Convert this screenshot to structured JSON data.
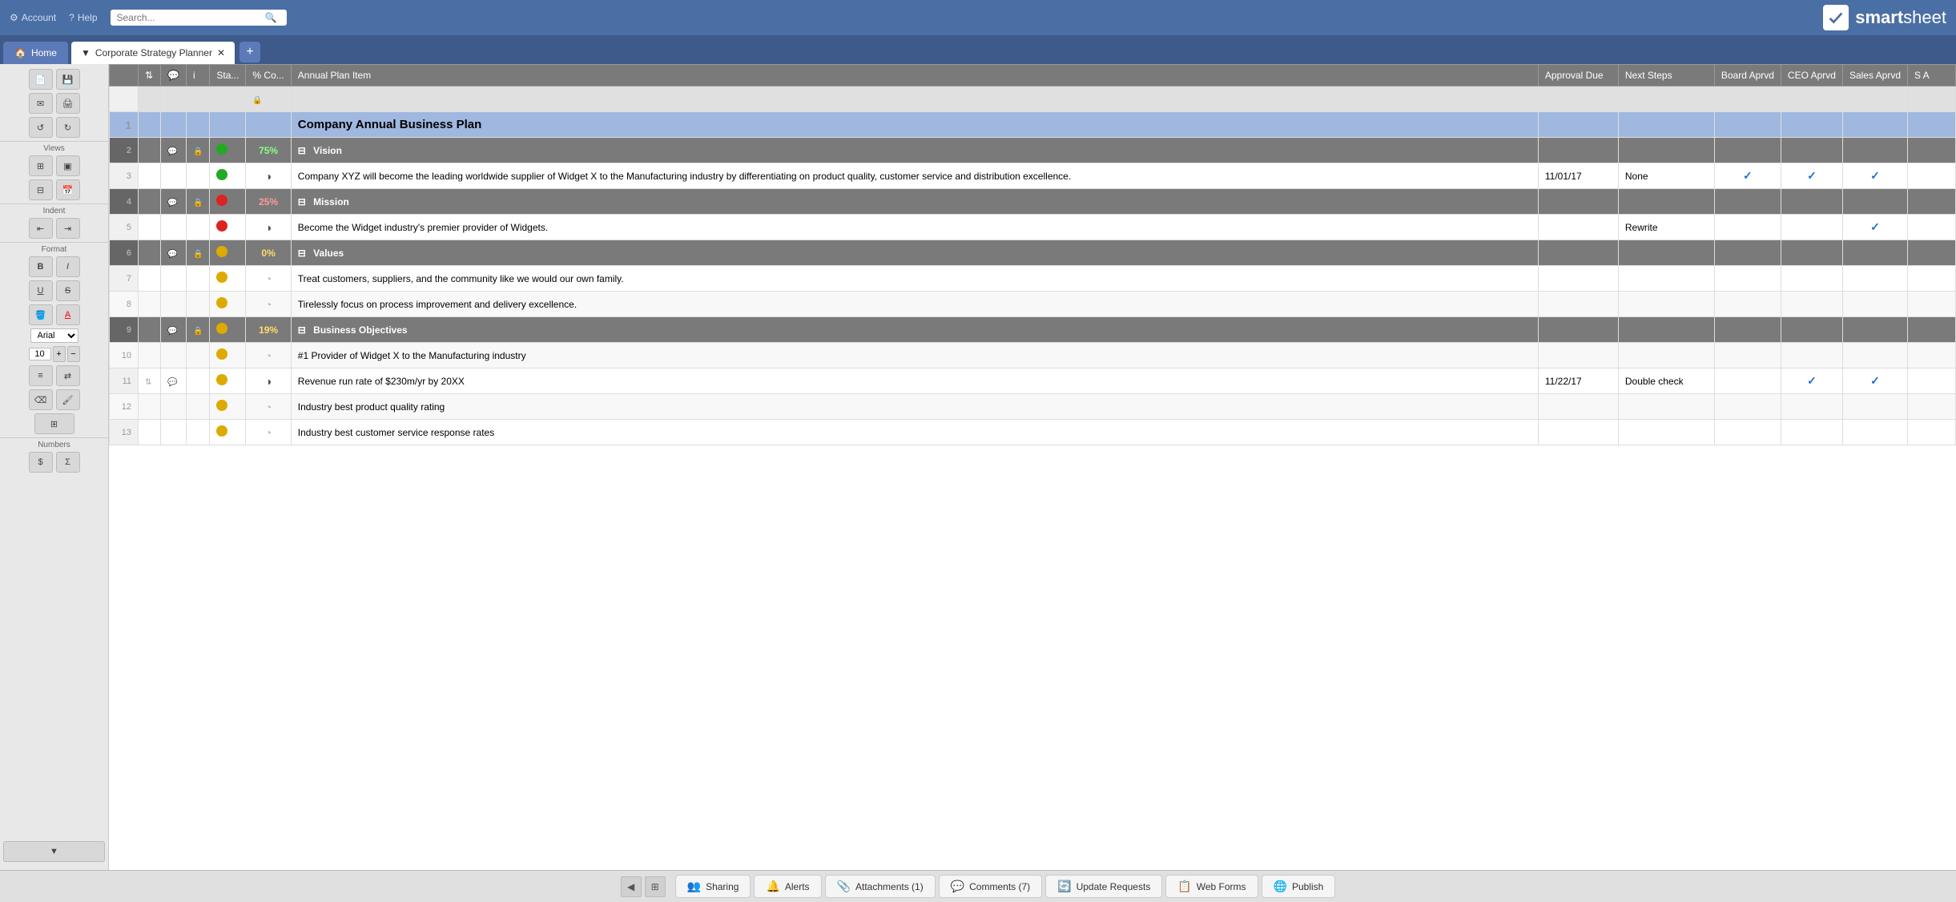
{
  "topbar": {
    "account_label": "Account",
    "help_label": "Help",
    "search_placeholder": "Search...",
    "logo_smart": "smart",
    "logo_sheet": "sheet"
  },
  "tabs": {
    "home_label": "Home",
    "sheet_label": "Corporate Strategy Planner",
    "add_label": "+"
  },
  "toolbar": {
    "views_label": "Views",
    "indent_label": "Indent",
    "format_label": "Format",
    "numbers_label": "Numbers",
    "font_name": "Arial",
    "font_size": "10"
  },
  "grid": {
    "columns": [
      {
        "id": "rownum",
        "label": ""
      },
      {
        "id": "move",
        "label": ""
      },
      {
        "id": "comment",
        "label": ""
      },
      {
        "id": "info",
        "label": "i"
      },
      {
        "id": "status",
        "label": "Sta..."
      },
      {
        "id": "pct",
        "label": "% Co..."
      },
      {
        "id": "main",
        "label": "Annual Plan Item"
      },
      {
        "id": "approval_due",
        "label": "Approval Due"
      },
      {
        "id": "next_steps",
        "label": "Next Steps"
      },
      {
        "id": "board_aprvd",
        "label": "Board Aprvd"
      },
      {
        "id": "ceo_aprvd",
        "label": "CEO Aprvd"
      },
      {
        "id": "sales_aprvd",
        "label": "Sales Aprvd"
      },
      {
        "id": "s_a",
        "label": "S A"
      }
    ],
    "rows": [
      {
        "rownum": "",
        "type": "subheader",
        "main": "",
        "status": "",
        "pct": "",
        "approval_due": "",
        "next_steps": "",
        "board": "",
        "ceo": "",
        "sales": "",
        "lock": true
      },
      {
        "rownum": "1",
        "type": "header",
        "main": "Company Annual Business Plan",
        "status": "",
        "pct": "",
        "approval_due": "",
        "next_steps": "",
        "board": "",
        "ceo": "",
        "sales": ""
      },
      {
        "rownum": "2",
        "type": "section",
        "main": "Vision",
        "status": "green",
        "pct": "75%",
        "pct_color": "green",
        "approval_due": "",
        "next_steps": "",
        "board": "",
        "ceo": "",
        "sales": "",
        "comment": true,
        "lock": true
      },
      {
        "rownum": "3",
        "type": "data",
        "main": "Company XYZ will become the leading worldwide supplier of Widget X to the Manufacturing industry by differentiating on product quality, customer service and distribution excellence.",
        "status": "green",
        "pie": true,
        "approval_due": "11/01/17",
        "next_steps": "None",
        "board": true,
        "ceo": true,
        "sales": true
      },
      {
        "rownum": "4",
        "type": "section",
        "main": "Mission",
        "status": "red",
        "pct": "25%",
        "pct_color": "red",
        "approval_due": "",
        "next_steps": "",
        "board": "",
        "ceo": "",
        "sales": "",
        "comment": true,
        "lock": true
      },
      {
        "rownum": "5",
        "type": "data",
        "main": "Become the Widget industry's premier provider of Widgets.",
        "status": "red",
        "pie": true,
        "approval_due": "",
        "next_steps": "Rewrite",
        "board": "",
        "ceo": "",
        "sales": true
      },
      {
        "rownum": "6",
        "type": "section",
        "main": "Values",
        "status": "yellow",
        "pct": "0%",
        "pct_color": "yellow",
        "approval_due": "",
        "next_steps": "",
        "board": "",
        "ceo": "",
        "sales": "",
        "comment": true,
        "lock": true
      },
      {
        "rownum": "7",
        "type": "data",
        "main": "Treat customers, suppliers, and the community like we would our own family.",
        "status": "yellow",
        "pie": "gray",
        "approval_due": "",
        "next_steps": "",
        "board": "",
        "ceo": "",
        "sales": ""
      },
      {
        "rownum": "8",
        "type": "data",
        "main": "Tirelessly focus on process improvement and delivery excellence.",
        "status": "yellow",
        "pie": "gray",
        "approval_due": "",
        "next_steps": "",
        "board": "",
        "ceo": "",
        "sales": ""
      },
      {
        "rownum": "9",
        "type": "section",
        "main": "Business Objectives",
        "status": "yellow",
        "pct": "19%",
        "pct_color": "yellow",
        "approval_due": "",
        "next_steps": "",
        "board": "",
        "ceo": "",
        "sales": "",
        "comment": true,
        "lock": true
      },
      {
        "rownum": "10",
        "type": "data",
        "main": "#1 Provider of Widget X to the Manufacturing industry",
        "status": "yellow",
        "pie": "gray",
        "approval_due": "",
        "next_steps": "",
        "board": "",
        "ceo": "",
        "sales": ""
      },
      {
        "rownum": "11",
        "type": "data",
        "main": "Revenue run rate of $230m/yr by 20XX",
        "status": "yellow",
        "pie": true,
        "approval_due": "11/22/17",
        "next_steps": "Double check",
        "board": "",
        "ceo": true,
        "sales": true,
        "move": true,
        "comment": true
      },
      {
        "rownum": "12",
        "type": "data",
        "main": "Industry best product quality rating",
        "status": "yellow",
        "pie": "gray",
        "approval_due": "",
        "next_steps": "",
        "board": "",
        "ceo": "",
        "sales": ""
      },
      {
        "rownum": "13",
        "type": "data",
        "main": "Industry best customer service response rates",
        "status": "yellow",
        "pie": "gray",
        "approval_due": "",
        "next_steps": "",
        "board": "",
        "ceo": "",
        "sales": ""
      }
    ]
  },
  "bottombar": {
    "sharing_label": "Sharing",
    "alerts_label": "Alerts",
    "attachments_label": "Attachments (1)",
    "comments_label": "Comments (7)",
    "update_requests_label": "Update Requests",
    "web_forms_label": "Web Forms",
    "publish_label": "Publish"
  }
}
